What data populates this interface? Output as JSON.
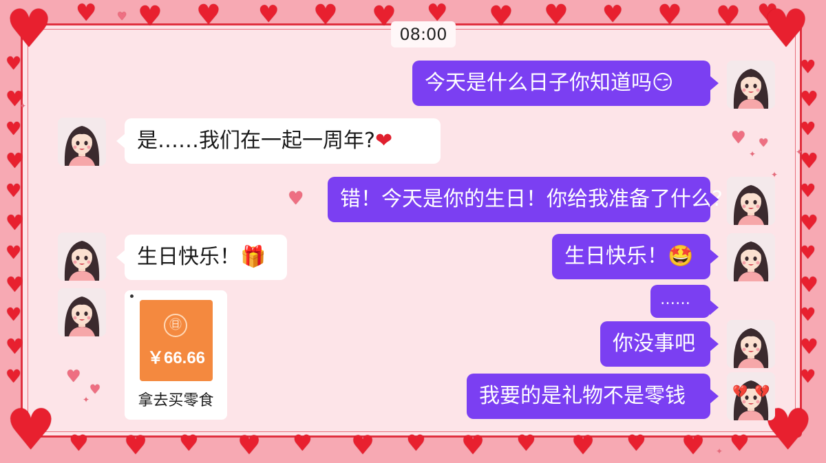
{
  "chat": {
    "time": "08:00",
    "messages": [
      {
        "side": "right",
        "text": "今天是什么日子你知道吗",
        "emoji": "smirk-face"
      },
      {
        "side": "left",
        "text": "是……我们在一起一周年?",
        "emoji": "red-heart"
      },
      {
        "side": "right",
        "text": "错！今天是你的生日！你给我准备了什么?"
      },
      {
        "side": "left",
        "text": "生日快乐！",
        "emoji": "gift-box"
      },
      {
        "side": "right",
        "text": "生日快乐！",
        "emoji": "grinning-face"
      },
      {
        "side": "right",
        "text": "……"
      },
      {
        "side": "right",
        "text": "你没事吧"
      },
      {
        "side": "right",
        "text": "我要的是礼物不是零钱",
        "avatar": "broken-heart-avatar"
      }
    ],
    "red_packet": {
      "seal": "㊐",
      "amount": "￥66.66",
      "caption": "拿去买零食"
    }
  },
  "colors": {
    "outgoing_bubble": "#7b3ff2",
    "incoming_bubble": "#ffffff",
    "frame": "#e0303f",
    "background": "#fde4e8",
    "red_packet": "#f4893f"
  }
}
